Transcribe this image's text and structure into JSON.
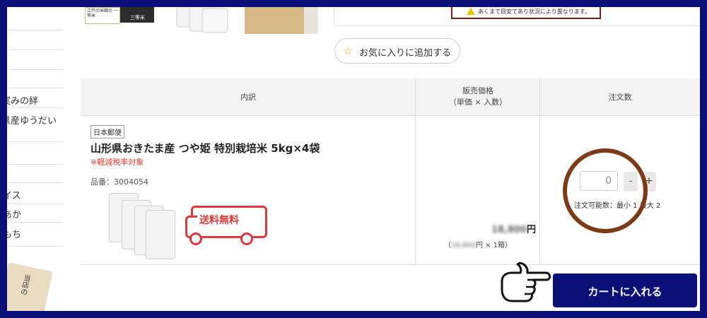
{
  "sidebar": {
    "items": [
      "",
      "",
      "",
      "実みの絆",
      "県産ゆうだい",
      "",
      "",
      "イス",
      "あか",
      "もち"
    ],
    "paper_text": "当店の"
  },
  "top_images": {
    "thumb1_text": "江戸の米蔵の\n一等米",
    "thumb2_text": "三等米"
  },
  "notice": {
    "text": "あくまで目安であり状況により異なります。"
  },
  "favorite": {
    "label": "お気に入りに追加する"
  },
  "table": {
    "headers": {
      "breakdown": "内訳",
      "price_line1": "販売価格",
      "price_line2": "（単価 × 入数）",
      "order_qty": "注文数"
    }
  },
  "product": {
    "shipping_badge": "日本郵便",
    "name": "山形県おきたま産 つや姫 特別栽培米 5kg×4袋",
    "tax_note": "※軽減税率対象",
    "sku": "品番：3004054",
    "free_shipping_label": "送料無料",
    "price_blur": "18,800",
    "price_unit": "円",
    "price_sub_open": "（",
    "price_sub_blur": "18,800",
    "price_sub_rest": "円 × 1箱）"
  },
  "quantity": {
    "value": "0",
    "minus": "-",
    "plus": "+",
    "available": "注文可能数：最小 1 最大 2"
  },
  "cart": {
    "label": "カートに入れる"
  },
  "colors": {
    "frame": "#0b1078",
    "accent_red": "#e0393c",
    "circle": "#7d3a16",
    "star": "#e0b100"
  }
}
